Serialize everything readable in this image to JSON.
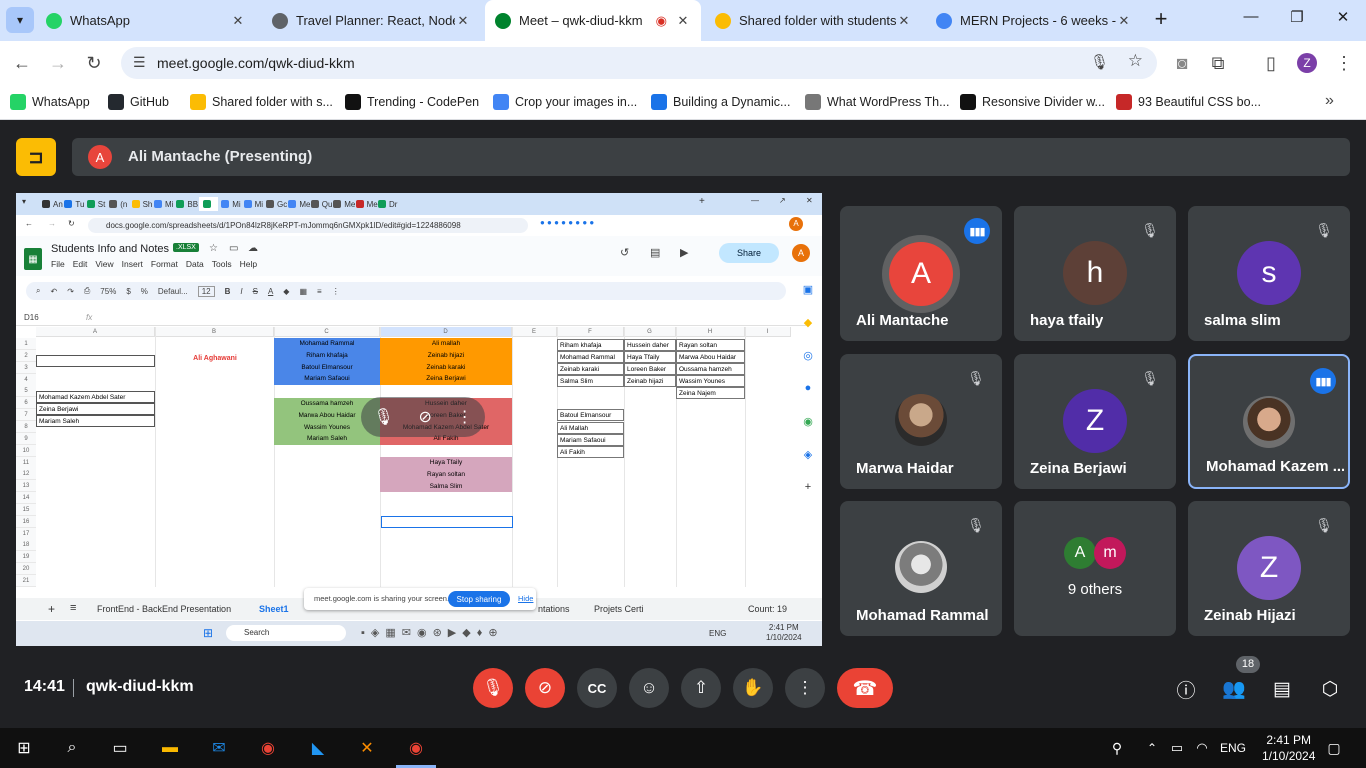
{
  "browser": {
    "tabs": [
      {
        "title": "WhatsApp",
        "icon": "whatsapp-icon",
        "color": "#25d366"
      },
      {
        "title": "Travel Planner: React, Node,",
        "icon": "codepen-icon",
        "color": "#5f6368"
      },
      {
        "title": "Meet – qwk-diud-kkm",
        "icon": "meet-icon",
        "color": "#00832d",
        "active": true
      },
      {
        "title": "Shared folder with students",
        "icon": "drive-icon",
        "color": "#fbbc04"
      },
      {
        "title": "MERN Projects - 6 weeks - G",
        "icon": "docs-icon",
        "color": "#4285f4"
      }
    ],
    "url": "meet.google.com/qwk-diud-kkm",
    "bookmarks": [
      {
        "label": "WhatsApp",
        "icon": "whatsapp-icon",
        "color": "#25d366"
      },
      {
        "label": "GitHub",
        "icon": "github-icon",
        "color": "#24292f"
      },
      {
        "label": "Shared folder with s...",
        "icon": "drive-icon",
        "color": "#fbbc04"
      },
      {
        "label": "Trending - CodePen",
        "icon": "codepen-icon",
        "color": "#111"
      },
      {
        "label": "Crop your images in...",
        "icon": "crop-icon",
        "color": "#4285f4"
      },
      {
        "label": "Building a Dynamic...",
        "icon": "c-icon",
        "color": "#1a73e8"
      },
      {
        "label": "What WordPress Th...",
        "icon": "wordpress-icon",
        "color": "#777"
      },
      {
        "label": "Resonsive Divider w...",
        "icon": "codepen-icon",
        "color": "#111"
      },
      {
        "label": "93 Beautiful CSS bo...",
        "icon": "bookmark-icon",
        "color": "#c62828"
      }
    ]
  },
  "meet": {
    "presenter_initial": "A",
    "presenter_label": "Ali Mantache (Presenting)",
    "time": "14:41",
    "meeting_code": "qwk-diud-kkm",
    "people_count": "18",
    "participants": [
      {
        "name": "Ali Mantache",
        "initial": "A",
        "color": "#e8453c",
        "speaking": true,
        "muted": false
      },
      {
        "name": "haya tfaily",
        "initial": "h",
        "color": "#5d4037",
        "muted": true
      },
      {
        "name": "salma slim",
        "initial": "s",
        "color": "#5e35b1",
        "muted": true
      },
      {
        "name": "Marwa Haidar",
        "initial": "",
        "color": "",
        "photo": true,
        "muted": true
      },
      {
        "name": "Zeina Berjawi",
        "initial": "Z",
        "color": "#512da8",
        "muted": true
      },
      {
        "name": "Mohamad Kazem ...",
        "initial": "",
        "color": "",
        "photo": true,
        "speaking": true,
        "highlighted": true
      },
      {
        "name": "Mohamad Rammal",
        "initial": "",
        "color": "",
        "photo": true,
        "muted": true
      },
      {
        "name": "9 others",
        "initial": "",
        "color": "",
        "others": true,
        "mini": [
          "A",
          "m"
        ]
      },
      {
        "name": "Zeinab Hijazi",
        "initial": "Z",
        "color": "#7e57c2",
        "muted": true
      }
    ]
  },
  "shared_screen": {
    "inner_tabs": [
      "An",
      "Tu",
      "St",
      "(n",
      "Sh",
      "Mi",
      "BB",
      "",
      "Mi",
      "Mi",
      "Gc",
      "Me",
      "Qu",
      "Me",
      "Me",
      "Dr"
    ],
    "inner_url": "docs.google.com/spreadsheets/d/1POn84lzR8jKeRPT-mJommq6nGMXpk1lD/edit#gid=1224886098",
    "sheet_title": "Students Info and Notes",
    "xlsx": ".XLSX",
    "menus": [
      "File",
      "Edit",
      "View",
      "Insert",
      "Format",
      "Data",
      "Tools",
      "Help"
    ],
    "share_label": "Share",
    "zoom": "75%",
    "font": "Defaul...",
    "font_size": "12",
    "cell_ref": "D16",
    "col_headers": [
      "A",
      "B",
      "C",
      "D",
      "E",
      "F",
      "G",
      "H",
      "I"
    ],
    "row_numbers": [
      "1",
      "2",
      "3",
      "4",
      "5",
      "6",
      "7",
      "8",
      "9",
      "10",
      "11",
      "12",
      "13",
      "14",
      "15",
      "16",
      "17",
      "18",
      "19",
      "20",
      "21"
    ],
    "title_cell": "Ali Aghawani",
    "col_a_names": [
      "Mohamad Kazem Abdel Sater",
      "Zeina Berjawi",
      "Mariam Saleh"
    ],
    "blue_group": [
      "Mohamad Rammal",
      "Riham khafaja",
      "Batoul Elmansour",
      "Mariam Safaoui"
    ],
    "orange_group": [
      "Ali mallah",
      "Zeinab hijazi",
      "Zeinab karaki",
      "Zeina Berjawi"
    ],
    "green_group": [
      "Oussama hamzeh",
      "Marwa Abou Haidar",
      "Wassim Younes",
      "Mariam Saleh"
    ],
    "red_group": [
      "Hussein daher",
      "Loreen Baker",
      "Mohamad Kazem Abdel Sater",
      "Ali Fakih"
    ],
    "pink_group": [
      "Haya Tfaily",
      "Rayan soltan",
      "Salma Slim"
    ],
    "list_f_top": [
      "Riham khafaja",
      "Mohamad Rammal",
      "Zeinab karaki",
      "Salma Slim"
    ],
    "list_g_top": [
      "Hussein daher",
      "Haya Tfaily",
      "Loreen Baker",
      "Zeinab hijazi"
    ],
    "list_h_top": [
      "Rayan soltan",
      "Marwa Abou Haidar",
      "Oussama hamzeh",
      "Wassim Younes",
      "Zeina Najem"
    ],
    "list_f_mid": [
      "Batoul Elmansour"
    ],
    "list_f_bottom": [
      "Ali Mallah",
      "Mariam Safaoui",
      "Ali Fakih"
    ],
    "sheet_tabs": [
      "FrontEnd - BackEnd Presentation",
      "Sheet1",
      "ntations",
      "Projets Certi"
    ],
    "count": "Count: 19",
    "sharing_text": "meet.google.com is sharing your screen.",
    "stop_sharing": "Stop sharing",
    "hide": "Hide",
    "search": "Search",
    "lang": "ENG",
    "inner_time": "2:41 PM",
    "inner_date": "1/10/2024"
  },
  "taskbar": {
    "lang": "ENG",
    "time": "2:41 PM",
    "date": "1/10/2024"
  }
}
